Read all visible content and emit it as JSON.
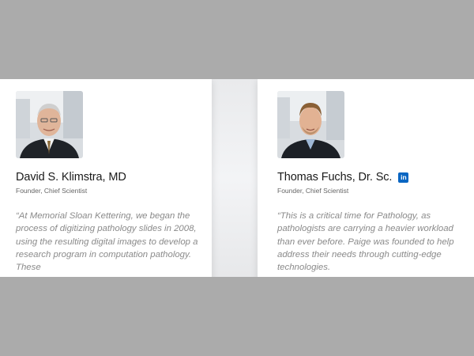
{
  "profiles": [
    {
      "name": "David S. Klimstra, MD",
      "role": "Founder, Chief Scientist",
      "quote": "“At Memorial Sloan Kettering, we began the process of digitizing pathology slides in 2008, using the resulting digital images to develop a research program in computation pathology. These",
      "photo_icon": "portrait-photo"
    },
    {
      "name": "Thomas Fuchs, Dr. Sc.",
      "role": "Founder, Chief Scientist",
      "quote": "“This is a critical time for Pathology, as pathologists are carrying a heavier workload than ever before. Paige was founded to help address their needs through cutting-edge technologies.",
      "photo_icon": "portrait-photo",
      "social": "in"
    }
  ],
  "colors": {
    "background": "#ababab",
    "card": "#ffffff",
    "linkedin": "#0a66c2",
    "quote_text": "#8a8a8a"
  }
}
